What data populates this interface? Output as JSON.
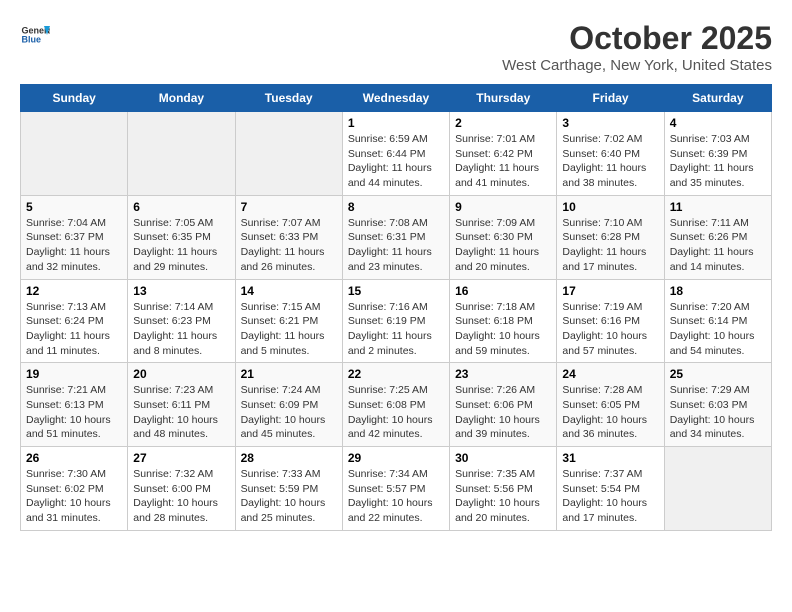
{
  "logo": {
    "general": "General",
    "blue": "Blue"
  },
  "title": "October 2025",
  "location": "West Carthage, New York, United States",
  "days_of_week": [
    "Sunday",
    "Monday",
    "Tuesday",
    "Wednesday",
    "Thursday",
    "Friday",
    "Saturday"
  ],
  "weeks": [
    [
      {
        "day": "",
        "info": ""
      },
      {
        "day": "",
        "info": ""
      },
      {
        "day": "",
        "info": ""
      },
      {
        "day": "1",
        "info": "Sunrise: 6:59 AM\nSunset: 6:44 PM\nDaylight: 11 hours and 44 minutes."
      },
      {
        "day": "2",
        "info": "Sunrise: 7:01 AM\nSunset: 6:42 PM\nDaylight: 11 hours and 41 minutes."
      },
      {
        "day": "3",
        "info": "Sunrise: 7:02 AM\nSunset: 6:40 PM\nDaylight: 11 hours and 38 minutes."
      },
      {
        "day": "4",
        "info": "Sunrise: 7:03 AM\nSunset: 6:39 PM\nDaylight: 11 hours and 35 minutes."
      }
    ],
    [
      {
        "day": "5",
        "info": "Sunrise: 7:04 AM\nSunset: 6:37 PM\nDaylight: 11 hours and 32 minutes."
      },
      {
        "day": "6",
        "info": "Sunrise: 7:05 AM\nSunset: 6:35 PM\nDaylight: 11 hours and 29 minutes."
      },
      {
        "day": "7",
        "info": "Sunrise: 7:07 AM\nSunset: 6:33 PM\nDaylight: 11 hours and 26 minutes."
      },
      {
        "day": "8",
        "info": "Sunrise: 7:08 AM\nSunset: 6:31 PM\nDaylight: 11 hours and 23 minutes."
      },
      {
        "day": "9",
        "info": "Sunrise: 7:09 AM\nSunset: 6:30 PM\nDaylight: 11 hours and 20 minutes."
      },
      {
        "day": "10",
        "info": "Sunrise: 7:10 AM\nSunset: 6:28 PM\nDaylight: 11 hours and 17 minutes."
      },
      {
        "day": "11",
        "info": "Sunrise: 7:11 AM\nSunset: 6:26 PM\nDaylight: 11 hours and 14 minutes."
      }
    ],
    [
      {
        "day": "12",
        "info": "Sunrise: 7:13 AM\nSunset: 6:24 PM\nDaylight: 11 hours and 11 minutes."
      },
      {
        "day": "13",
        "info": "Sunrise: 7:14 AM\nSunset: 6:23 PM\nDaylight: 11 hours and 8 minutes."
      },
      {
        "day": "14",
        "info": "Sunrise: 7:15 AM\nSunset: 6:21 PM\nDaylight: 11 hours and 5 minutes."
      },
      {
        "day": "15",
        "info": "Sunrise: 7:16 AM\nSunset: 6:19 PM\nDaylight: 11 hours and 2 minutes."
      },
      {
        "day": "16",
        "info": "Sunrise: 7:18 AM\nSunset: 6:18 PM\nDaylight: 10 hours and 59 minutes."
      },
      {
        "day": "17",
        "info": "Sunrise: 7:19 AM\nSunset: 6:16 PM\nDaylight: 10 hours and 57 minutes."
      },
      {
        "day": "18",
        "info": "Sunrise: 7:20 AM\nSunset: 6:14 PM\nDaylight: 10 hours and 54 minutes."
      }
    ],
    [
      {
        "day": "19",
        "info": "Sunrise: 7:21 AM\nSunset: 6:13 PM\nDaylight: 10 hours and 51 minutes."
      },
      {
        "day": "20",
        "info": "Sunrise: 7:23 AM\nSunset: 6:11 PM\nDaylight: 10 hours and 48 minutes."
      },
      {
        "day": "21",
        "info": "Sunrise: 7:24 AM\nSunset: 6:09 PM\nDaylight: 10 hours and 45 minutes."
      },
      {
        "day": "22",
        "info": "Sunrise: 7:25 AM\nSunset: 6:08 PM\nDaylight: 10 hours and 42 minutes."
      },
      {
        "day": "23",
        "info": "Sunrise: 7:26 AM\nSunset: 6:06 PM\nDaylight: 10 hours and 39 minutes."
      },
      {
        "day": "24",
        "info": "Sunrise: 7:28 AM\nSunset: 6:05 PM\nDaylight: 10 hours and 36 minutes."
      },
      {
        "day": "25",
        "info": "Sunrise: 7:29 AM\nSunset: 6:03 PM\nDaylight: 10 hours and 34 minutes."
      }
    ],
    [
      {
        "day": "26",
        "info": "Sunrise: 7:30 AM\nSunset: 6:02 PM\nDaylight: 10 hours and 31 minutes."
      },
      {
        "day": "27",
        "info": "Sunrise: 7:32 AM\nSunset: 6:00 PM\nDaylight: 10 hours and 28 minutes."
      },
      {
        "day": "28",
        "info": "Sunrise: 7:33 AM\nSunset: 5:59 PM\nDaylight: 10 hours and 25 minutes."
      },
      {
        "day": "29",
        "info": "Sunrise: 7:34 AM\nSunset: 5:57 PM\nDaylight: 10 hours and 22 minutes."
      },
      {
        "day": "30",
        "info": "Sunrise: 7:35 AM\nSunset: 5:56 PM\nDaylight: 10 hours and 20 minutes."
      },
      {
        "day": "31",
        "info": "Sunrise: 7:37 AM\nSunset: 5:54 PM\nDaylight: 10 hours and 17 minutes."
      },
      {
        "day": "",
        "info": ""
      }
    ]
  ]
}
